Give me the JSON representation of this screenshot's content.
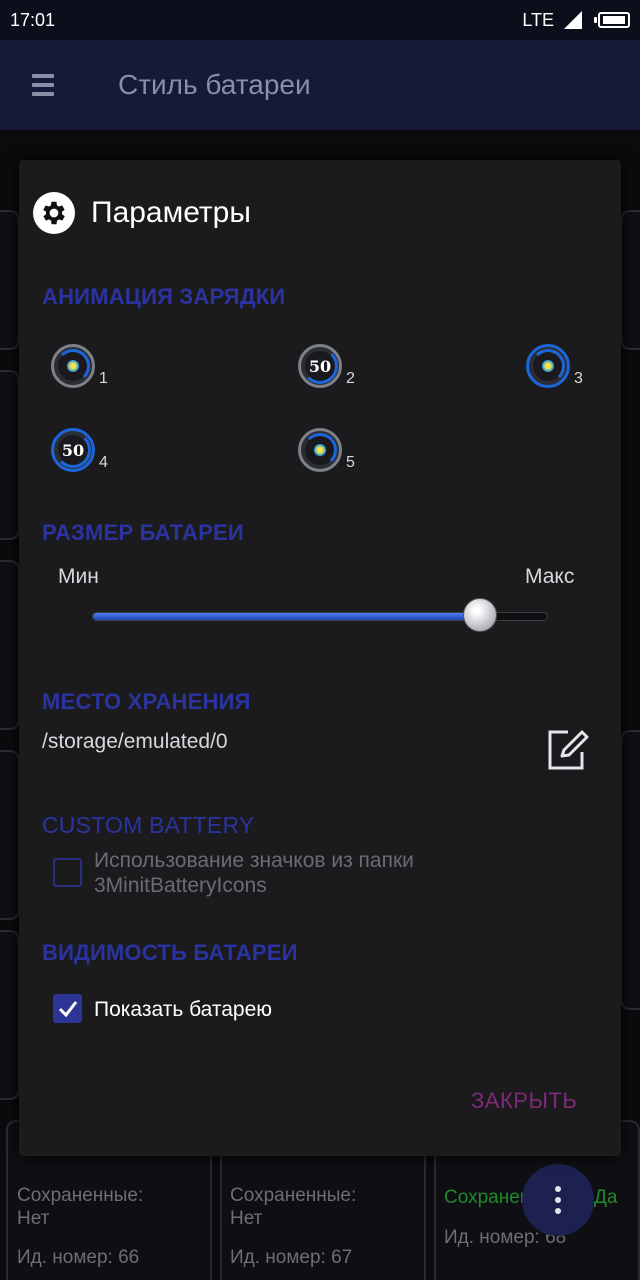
{
  "status_bar": {
    "time": "17:01",
    "network": "LTE"
  },
  "app_bar": {
    "title": "Стиль батареи"
  },
  "dialog": {
    "title": "Параметры",
    "charging_animation": {
      "heading": "АНИМАЦИЯ ЗАРЯДКИ",
      "options": [
        {
          "label": "1",
          "icon": "swirl-ring-icon"
        },
        {
          "label": "2",
          "icon": "fifty-ring-icon"
        },
        {
          "label": "3",
          "icon": "swirl-blue-ring-icon"
        },
        {
          "label": "4",
          "icon": "fifty-blue-ring-icon"
        },
        {
          "label": "5",
          "icon": "swirl-ring-icon"
        }
      ]
    },
    "battery_size": {
      "heading": "РАЗМЕР БАТАРЕИ",
      "min_label": "Мин",
      "max_label": "Макс",
      "value_fraction": 0.85
    },
    "storage": {
      "heading": "МЕСТО ХРАНЕНИЯ",
      "path": "/storage/emulated/0",
      "edit_icon": "edit-icon"
    },
    "custom_battery": {
      "heading": "CUSTOM BATTERY",
      "checkbox_label_line1": "Использование значков из папки",
      "checkbox_label_line2": "3MinitBatteryIcons",
      "checked": false
    },
    "battery_visibility": {
      "heading": "ВИДИМОСТЬ БАТАРЕИ",
      "checkbox_label": "Показать батарею",
      "checked": true
    },
    "close_label": "ЗАКРЫТЬ"
  },
  "background_cards": [
    {
      "saved_label": "Сохраненные:",
      "saved_value": "Нет",
      "id_label": "Ид. номер: 66"
    },
    {
      "saved_label": "Сохраненные:",
      "saved_value": "Нет",
      "id_label": "Ид. номер: 67"
    },
    {
      "saved_label": "Сохранен",
      "saved_value": "Да",
      "id_label": "Ид. номер: 68"
    }
  ],
  "colors": {
    "accent": "#2a33a0",
    "close": "#7e2a78",
    "appbar": "#161a38",
    "dialog_bg": "#1b1b1d",
    "saved_yes": "#1e8a2a"
  }
}
